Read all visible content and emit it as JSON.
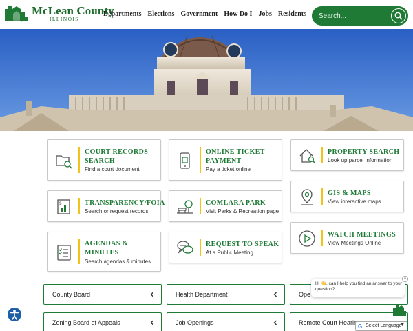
{
  "header": {
    "logo_sub": "McLean County",
    "brand_title": "McLean County",
    "brand_subtitle": "ILLINOIS",
    "nav": [
      "Departments",
      "Elections",
      "Government",
      "How Do I",
      "Jobs",
      "Residents"
    ],
    "search_placeholder": "Search...",
    "search_icon": "search-icon"
  },
  "colors": {
    "brand_green": "#1e7a35",
    "accent_yellow": "#f0c419",
    "sky_blue": "#3e79d6"
  },
  "cards": [
    {
      "title": "COURT RECORDS SEARCH",
      "subtitle": "Find a court document",
      "icon": "folder-search-icon"
    },
    {
      "title": "ONLINE TICKET PAYMENT",
      "subtitle": "Pay a ticket online",
      "icon": "phone-payment-icon"
    },
    {
      "title": "PROPERTY SEARCH",
      "subtitle": "Look up parcel information",
      "icon": "house-search-icon"
    },
    {
      "title": "TRANSPARENCY/FOIA",
      "subtitle": "Search or request records",
      "icon": "records-chart-icon"
    },
    {
      "title": "COMLARA PARK",
      "subtitle": "Visit Parks & Recreation page",
      "icon": "park-bench-icon"
    },
    {
      "title": "GIS & MAPS",
      "subtitle": "View interactive maps",
      "icon": "map-pin-icon"
    },
    {
      "title": "AGENDAS & MINUTES",
      "subtitle": "Search agendas & minutes",
      "icon": "checklist-icon"
    },
    {
      "title": "REQUEST TO SPEAK",
      "subtitle": "At a Public Meeting",
      "icon": "speech-bubbles-icon"
    },
    {
      "title": "WATCH MEETINGS",
      "subtitle": "View Meetings Online",
      "icon": "play-circle-icon"
    }
  ],
  "accordions": [
    {
      "label": "County Board"
    },
    {
      "label": "Health Department"
    },
    {
      "label": "Ope"
    },
    {
      "label": "Zoning Board of Appeals"
    },
    {
      "label": "Job Openings"
    },
    {
      "label": "Remote Court Hearings"
    }
  ],
  "chat": {
    "message": "Hi 👋, can I help you find an answer to your question?",
    "close": "×"
  },
  "translate": {
    "label": "Select Language",
    "g": "G",
    "arrow": "▼"
  }
}
